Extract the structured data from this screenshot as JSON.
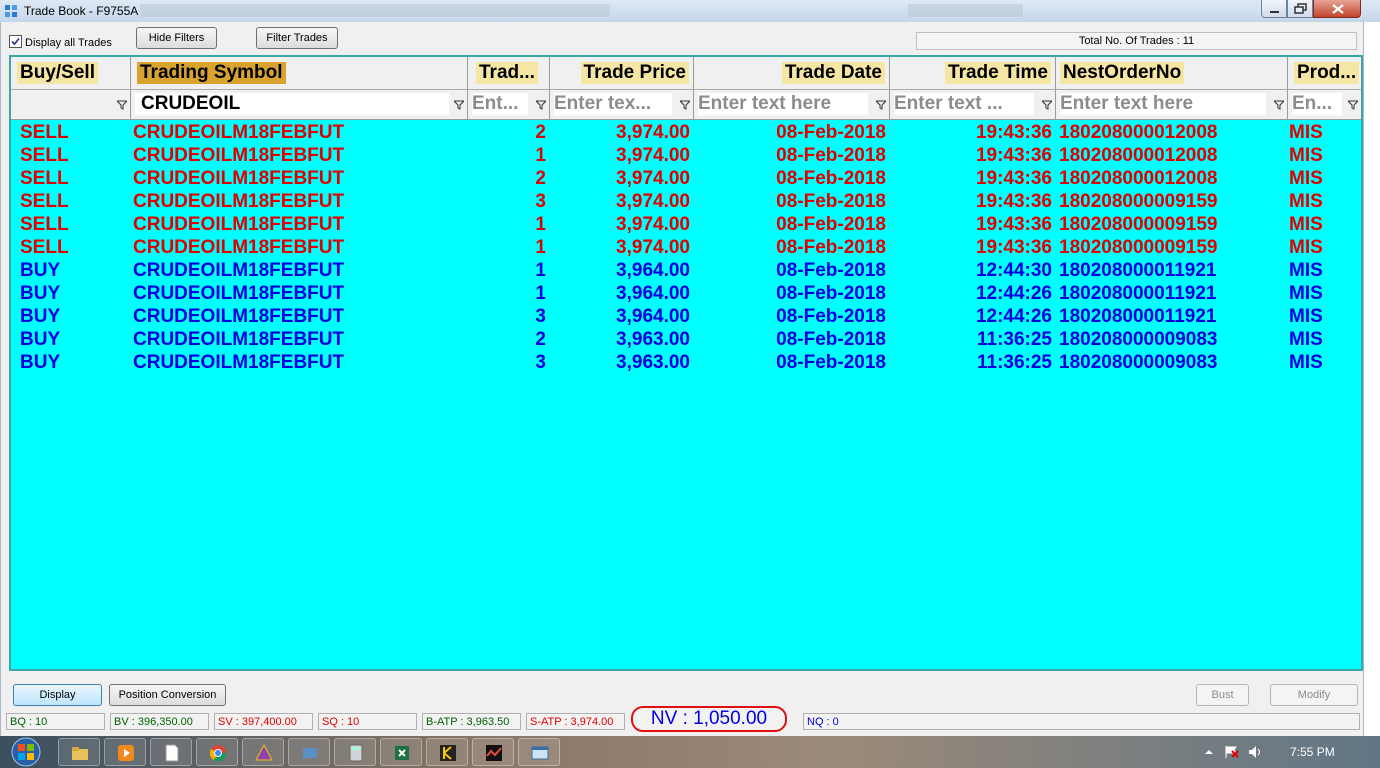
{
  "window": {
    "title": "Trade Book - F9755A"
  },
  "toolbar": {
    "display_all_label": "Display all Trades",
    "display_all_checked": true,
    "hide_filters_label": "Hide Filters",
    "filter_trades_label": "Filter Trades",
    "total_trades_label": "Total No. Of Trades : 11"
  },
  "grid": {
    "columns": [
      "Buy/Sell",
      "Trading Symbol",
      "Trad...",
      "Trade Price",
      "Trade Date",
      "Trade Time",
      "NestOrderNo",
      "Prod..."
    ],
    "filters": [
      "",
      "CRUDEOIL",
      "Ent...",
      "Enter tex...",
      "Enter text here",
      "Enter text ...",
      "Enter text here",
      "En..."
    ],
    "rows": [
      {
        "side": "SELL",
        "symbol": "CRUDEOILM18FEBFUT",
        "qty": "2",
        "price": "3,974.00",
        "date": "08-Feb-2018",
        "time": "19:43:36",
        "order": "180208000012008",
        "product": "MIS"
      },
      {
        "side": "SELL",
        "symbol": "CRUDEOILM18FEBFUT",
        "qty": "1",
        "price": "3,974.00",
        "date": "08-Feb-2018",
        "time": "19:43:36",
        "order": "180208000012008",
        "product": "MIS"
      },
      {
        "side": "SELL",
        "symbol": "CRUDEOILM18FEBFUT",
        "qty": "2",
        "price": "3,974.00",
        "date": "08-Feb-2018",
        "time": "19:43:36",
        "order": "180208000012008",
        "product": "MIS"
      },
      {
        "side": "SELL",
        "symbol": "CRUDEOILM18FEBFUT",
        "qty": "3",
        "price": "3,974.00",
        "date": "08-Feb-2018",
        "time": "19:43:36",
        "order": "180208000009159",
        "product": "MIS"
      },
      {
        "side": "SELL",
        "symbol": "CRUDEOILM18FEBFUT",
        "qty": "1",
        "price": "3,974.00",
        "date": "08-Feb-2018",
        "time": "19:43:36",
        "order": "180208000009159",
        "product": "MIS"
      },
      {
        "side": "SELL",
        "symbol": "CRUDEOILM18FEBFUT",
        "qty": "1",
        "price": "3,974.00",
        "date": "08-Feb-2018",
        "time": "19:43:36",
        "order": "180208000009159",
        "product": "MIS"
      },
      {
        "side": "BUY",
        "symbol": "CRUDEOILM18FEBFUT",
        "qty": "1",
        "price": "3,964.00",
        "date": "08-Feb-2018",
        "time": "12:44:30",
        "order": "180208000011921",
        "product": "MIS"
      },
      {
        "side": "BUY",
        "symbol": "CRUDEOILM18FEBFUT",
        "qty": "1",
        "price": "3,964.00",
        "date": "08-Feb-2018",
        "time": "12:44:26",
        "order": "180208000011921",
        "product": "MIS"
      },
      {
        "side": "BUY",
        "symbol": "CRUDEOILM18FEBFUT",
        "qty": "3",
        "price": "3,964.00",
        "date": "08-Feb-2018",
        "time": "12:44:26",
        "order": "180208000011921",
        "product": "MIS"
      },
      {
        "side": "BUY",
        "symbol": "CRUDEOILM18FEBFUT",
        "qty": "2",
        "price": "3,963.00",
        "date": "08-Feb-2018",
        "time": "11:36:25",
        "order": "180208000009083",
        "product": "MIS"
      },
      {
        "side": "BUY",
        "symbol": "CRUDEOILM18FEBFUT",
        "qty": "3",
        "price": "3,963.00",
        "date": "08-Feb-2018",
        "time": "11:36:25",
        "order": "180208000009083",
        "product": "MIS"
      }
    ]
  },
  "bottom_buttons": {
    "display": "Display",
    "position_conversion": "Position Conversion",
    "bust": "Bust",
    "modify": "Modify"
  },
  "status": {
    "bq": "BQ : 10",
    "bv": "BV : 396,350.00",
    "sv": "SV : 397,400.00",
    "sq": "SQ : 10",
    "batp": "B-ATP : 3,963.50",
    "satp": "S-ATP : 3,974.00",
    "nv": "NV : 1,050.00",
    "nq": "NQ : 0"
  },
  "taskbar": {
    "clock": "7:55 PM",
    "icons": [
      "windows-start-icon",
      "file-explorer-icon",
      "media-player-icon",
      "document-icon",
      "chrome-icon",
      "paint-icon",
      "network-icon",
      "calculator-icon",
      "excel-icon",
      "trading-app-icon",
      "chart-app-icon",
      "window-app-icon"
    ]
  },
  "colors": {
    "grid_background": "#00ffff",
    "sell": "#e00000",
    "buy": "#0000e0",
    "header_label": "#f6e6a3",
    "header_selected": "#d9a42e",
    "nv_highlight": "#e01010"
  }
}
